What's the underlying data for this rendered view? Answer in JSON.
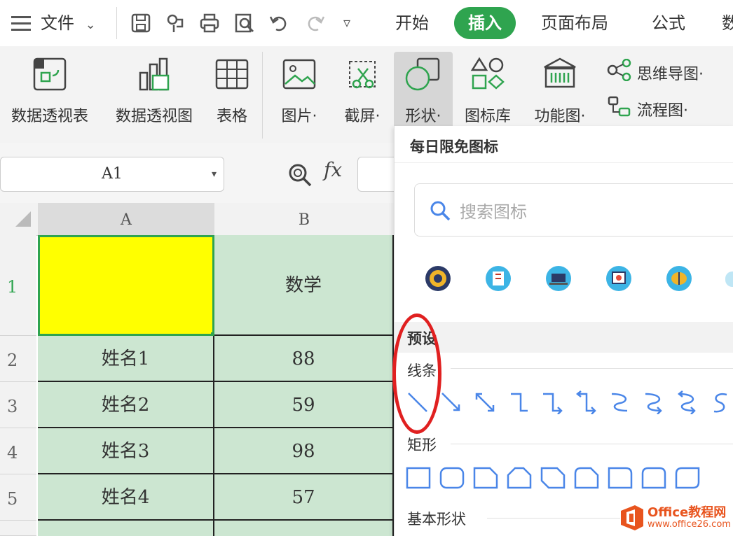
{
  "menubar": {
    "file_label": "文件",
    "tabs": [
      {
        "label": "开始"
      },
      {
        "label": "插入"
      },
      {
        "label": "页面布局"
      },
      {
        "label": "公式"
      },
      {
        "label": "数"
      }
    ]
  },
  "ribbon": {
    "buttons": [
      {
        "label": "数据透视表"
      },
      {
        "label": "数据透视图"
      },
      {
        "label": "表格"
      },
      {
        "label": "图片·"
      },
      {
        "label": "截屏·"
      },
      {
        "label": "形状·"
      },
      {
        "label": "图标库"
      },
      {
        "label": "功能图·"
      }
    ],
    "mindmap_label": "思维导图·",
    "flowchart_label": "流程图·"
  },
  "formula_bar": {
    "cell_ref": "A1",
    "fx": "fx"
  },
  "grid": {
    "columns": [
      "A",
      "B"
    ],
    "rows": [
      {
        "num": "1",
        "a": "",
        "b": "数学"
      },
      {
        "num": "2",
        "a": "姓名1",
        "b": "88"
      },
      {
        "num": "3",
        "a": "姓名2",
        "b": "59"
      },
      {
        "num": "4",
        "a": "姓名3",
        "b": "98"
      },
      {
        "num": "5",
        "a": "姓名4",
        "b": "57"
      }
    ]
  },
  "panel": {
    "title": "每日限免图标",
    "search_placeholder": "搜索图标",
    "preset_label": "预设",
    "lines_label": "线条",
    "rect_label": "矩形",
    "basic_label": "基本形状"
  },
  "watermark": {
    "text": "Office教程网",
    "url": "www.office26.com"
  },
  "colors": {
    "accent": "#2fa44f",
    "selected_cell": "#ffff00",
    "grid_fill": "#cce6d1",
    "shape_stroke": "#4a86e8",
    "highlight_circle": "#e02020"
  }
}
